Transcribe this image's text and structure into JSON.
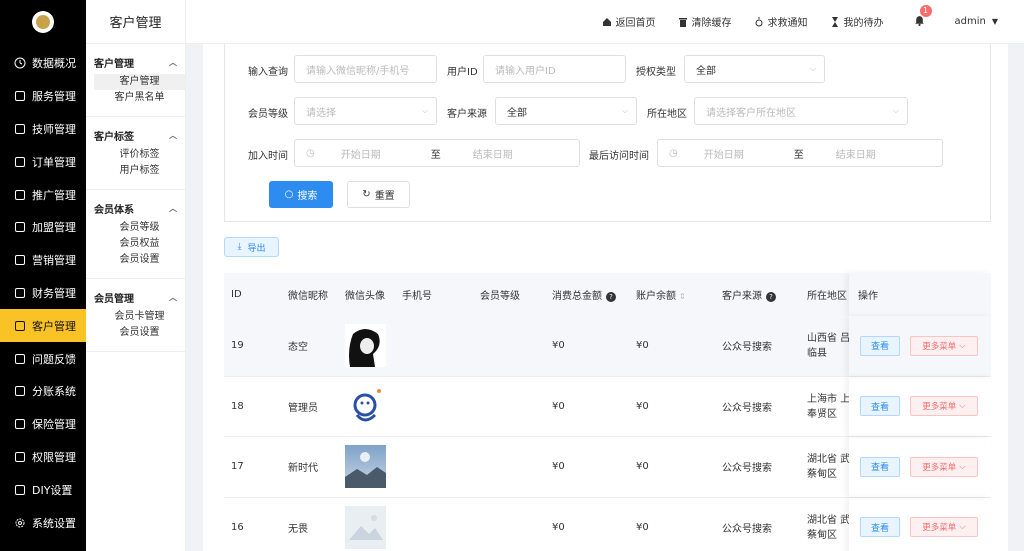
{
  "sidebar": {
    "items": [
      {
        "label": "数据概况",
        "icon": "clock-icon"
      },
      {
        "label": "服务管理",
        "icon": "service-icon"
      },
      {
        "label": "技师管理",
        "icon": "technician-icon"
      },
      {
        "label": "订单管理",
        "icon": "order-icon"
      },
      {
        "label": "推广管理",
        "icon": "promotion-icon"
      },
      {
        "label": "加盟管理",
        "icon": "franchise-icon"
      },
      {
        "label": "营销管理",
        "icon": "marketing-icon"
      },
      {
        "label": "财务管理",
        "icon": "finance-icon"
      },
      {
        "label": "客户管理",
        "icon": "customer-icon"
      },
      {
        "label": "问题反馈",
        "icon": "feedback-icon"
      },
      {
        "label": "分账系统",
        "icon": "split-icon"
      },
      {
        "label": "保险管理",
        "icon": "insurance-icon"
      },
      {
        "label": "权限管理",
        "icon": "permission-icon"
      },
      {
        "label": "DIY设置",
        "icon": "diy-icon"
      },
      {
        "label": "系统设置",
        "icon": "gear-icon"
      }
    ]
  },
  "submenu": {
    "title": "客户管理",
    "groups": [
      {
        "title": "客户管理",
        "links": [
          "客户管理",
          "客户黑名单"
        ]
      },
      {
        "title": "客户标签",
        "links": [
          "评价标签",
          "用户标签"
        ]
      },
      {
        "title": "会员体系",
        "links": [
          "会员等级",
          "会员权益",
          "会员设置"
        ]
      },
      {
        "title": "会员管理",
        "links": [
          "会员卡管理",
          "会员设置"
        ]
      }
    ]
  },
  "topbar": {
    "home": "返回首页",
    "clear_cache": "清除缓存",
    "rescue": "求救通知",
    "todo": "我的待办",
    "bell_count": "1",
    "user": "admin"
  },
  "filter": {
    "query_label": "输入查询",
    "query_placeholder": "请输入微信昵称/手机号",
    "userid_label": "用户ID",
    "userid_placeholder": "请输入用户ID",
    "auth_label": "授权类型",
    "auth_value": "全部",
    "level_label": "会员等级",
    "level_placeholder": "请选择",
    "source_label": "客户来源",
    "source_value": "全部",
    "region_label": "所在地区",
    "region_placeholder": "请选择客户所在地区",
    "join_label": "加入时间",
    "start_placeholder": "开始日期",
    "to": "至",
    "end_placeholder": "结束日期",
    "visit_label": "最后访问时间",
    "search_btn": "搜索",
    "reset_btn": "重置",
    "export_btn": "导出"
  },
  "table": {
    "headers": {
      "id": "ID",
      "nickname": "微信昵称",
      "avatar": "微信头像",
      "phone": "手机号",
      "level": "会员等级",
      "total": "消费总金额",
      "balance": "账户余额",
      "source": "客户来源",
      "region": "所在地区",
      "ops": "操作"
    },
    "rows": [
      {
        "id": "19",
        "nickname": "态空",
        "total": "¥0",
        "balance": "¥0",
        "source": "公众号搜索",
        "region1": "山西省 吕",
        "region2": "临县"
      },
      {
        "id": "18",
        "nickname": "管理员",
        "total": "¥0",
        "balance": "¥0",
        "source": "公众号搜索",
        "region1": "上海市 上",
        "region2": "奉贤区"
      },
      {
        "id": "17",
        "nickname": "新时代",
        "total": "¥0",
        "balance": "¥0",
        "source": "公众号搜索",
        "region1": "湖北省 武",
        "region2": "蔡甸区"
      },
      {
        "id": "16",
        "nickname": "无畏",
        "total": "¥0",
        "balance": "¥0",
        "source": "公众号搜索",
        "region1": "湖北省 武",
        "region2": "蔡甸区"
      }
    ],
    "view_btn": "查看",
    "more_btn": "更多菜单"
  }
}
